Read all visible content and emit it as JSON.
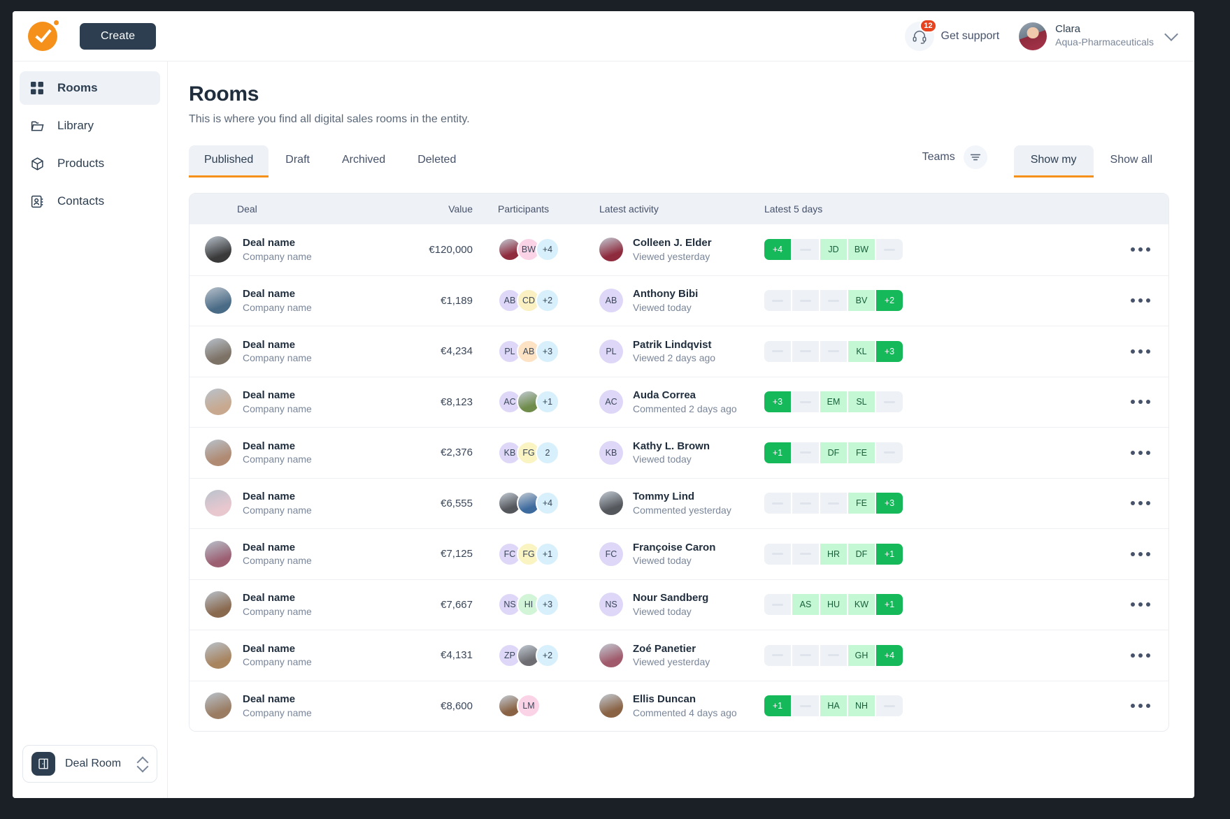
{
  "topbar": {
    "create_label": "Create",
    "support_label": "Get support",
    "support_badge": "12",
    "profile_name": "Clara",
    "profile_org": "Aqua-Pharmaceuticals"
  },
  "sidebar": {
    "items": [
      {
        "label": "Rooms",
        "icon": "grid-icon",
        "active": true
      },
      {
        "label": "Library",
        "icon": "folder-icon",
        "active": false
      },
      {
        "label": "Products",
        "icon": "cube-icon",
        "active": false
      },
      {
        "label": "Contacts",
        "icon": "contacts-icon",
        "active": false
      }
    ],
    "workspace_selector": {
      "label": "Deal Room",
      "icon": "door-icon"
    }
  },
  "page": {
    "title": "Rooms",
    "subtitle": "This is where you find all digital sales rooms in the entity."
  },
  "tabs": [
    {
      "label": "Published",
      "active": true
    },
    {
      "label": "Draft",
      "active": false
    },
    {
      "label": "Archived",
      "active": false
    },
    {
      "label": "Deleted",
      "active": false
    }
  ],
  "filters": {
    "teams_label": "Teams",
    "filter_icon": "filter-icon",
    "segments": [
      {
        "label": "Show my",
        "active": true
      },
      {
        "label": "Show all",
        "active": false
      }
    ]
  },
  "table": {
    "columns": [
      "Deal",
      "Value",
      "Participants",
      "Latest activity",
      "Latest 5 days"
    ],
    "rows": [
      {
        "deal": "Deal name",
        "company": "Company name",
        "value": "€120,000",
        "avatar_color": "#3a3a3a",
        "participants": [
          {
            "type": "photo",
            "color": "#8e2b3d"
          },
          {
            "type": "initials",
            "text": "BW",
            "color": "#fbd3e6"
          },
          {
            "type": "more",
            "text": "+4"
          }
        ],
        "activity": {
          "name": "Colleen J. Elder",
          "when": "Viewed yesterday",
          "avatar_type": "photo",
          "avatar_color": "#8e2b3d",
          "initials": ""
        },
        "days": [
          {
            "state": "solid",
            "text": "+4"
          },
          {
            "state": "empty",
            "text": ""
          },
          {
            "state": "light",
            "text": "JD"
          },
          {
            "state": "light",
            "text": "BW"
          },
          {
            "state": "empty",
            "text": ""
          }
        ]
      },
      {
        "deal": "Deal name",
        "company": "Company name",
        "value": "€1,189",
        "avatar_color": "#4a6b86",
        "participants": [
          {
            "type": "initials",
            "text": "AB",
            "color": "#ded7f7"
          },
          {
            "type": "initials",
            "text": "CD",
            "color": "#faf0c2"
          },
          {
            "type": "more",
            "text": "+2"
          }
        ],
        "activity": {
          "name": "Anthony Bibi",
          "when": "Viewed today",
          "avatar_type": "initials",
          "avatar_color": "#ded7f7",
          "initials": "AB"
        },
        "days": [
          {
            "state": "empty",
            "text": ""
          },
          {
            "state": "empty",
            "text": ""
          },
          {
            "state": "empty",
            "text": ""
          },
          {
            "state": "light",
            "text": "BV"
          },
          {
            "state": "solid",
            "text": "+2"
          }
        ]
      },
      {
        "deal": "Deal name",
        "company": "Company name",
        "value": "€4,234",
        "avatar_color": "#7d7266",
        "participants": [
          {
            "type": "initials",
            "text": "PL",
            "color": "#ded7f7"
          },
          {
            "type": "initials",
            "text": "AB",
            "color": "#fde2c4"
          },
          {
            "type": "more",
            "text": "+3"
          }
        ],
        "activity": {
          "name": "Patrik Lindqvist",
          "when": "Viewed 2 days ago",
          "avatar_type": "initials",
          "avatar_color": "#ded7f7",
          "initials": "PL"
        },
        "days": [
          {
            "state": "empty",
            "text": ""
          },
          {
            "state": "empty",
            "text": ""
          },
          {
            "state": "empty",
            "text": ""
          },
          {
            "state": "light",
            "text": "KL"
          },
          {
            "state": "solid",
            "text": "+3"
          }
        ]
      },
      {
        "deal": "Deal name",
        "company": "Company name",
        "value": "€8,123",
        "avatar_color": "#c8a98f",
        "participants": [
          {
            "type": "initials",
            "text": "AC",
            "color": "#ded7f7"
          },
          {
            "type": "photo",
            "color": "#6f8c4a"
          },
          {
            "type": "more",
            "text": "+1"
          }
        ],
        "activity": {
          "name": "Auda Correa",
          "when": "Commented 2 days ago",
          "avatar_type": "initials",
          "avatar_color": "#ded7f7",
          "initials": "AC"
        },
        "days": [
          {
            "state": "solid",
            "text": "+3"
          },
          {
            "state": "empty",
            "text": ""
          },
          {
            "state": "light",
            "text": "EM"
          },
          {
            "state": "light",
            "text": "SL"
          },
          {
            "state": "empty",
            "text": ""
          }
        ]
      },
      {
        "deal": "Deal name",
        "company": "Company name",
        "value": "€2,376",
        "avatar_color": "#b08a72",
        "participants": [
          {
            "type": "initials",
            "text": "KB",
            "color": "#ded7f7"
          },
          {
            "type": "initials",
            "text": "FG",
            "color": "#faf3c2"
          },
          {
            "type": "more",
            "text": "2"
          }
        ],
        "activity": {
          "name": "Kathy L. Brown",
          "when": "Viewed today",
          "avatar_type": "initials",
          "avatar_color": "#ded7f7",
          "initials": "KB"
        },
        "days": [
          {
            "state": "solid",
            "text": "+1"
          },
          {
            "state": "empty",
            "text": ""
          },
          {
            "state": "light",
            "text": "DF"
          },
          {
            "state": "light",
            "text": "FE"
          },
          {
            "state": "empty",
            "text": ""
          }
        ]
      },
      {
        "deal": "Deal name",
        "company": "Company name",
        "value": "€6,555",
        "avatar_color": "#e8c7cf",
        "participants": [
          {
            "type": "photo",
            "color": "#54575c"
          },
          {
            "type": "photo",
            "color": "#3d6b9e"
          },
          {
            "type": "more",
            "text": "+4"
          }
        ],
        "activity": {
          "name": "Tommy Lind",
          "when": "Commented yesterday",
          "avatar_type": "photo",
          "avatar_color": "#54575c",
          "initials": ""
        },
        "days": [
          {
            "state": "empty",
            "text": ""
          },
          {
            "state": "empty",
            "text": ""
          },
          {
            "state": "empty",
            "text": ""
          },
          {
            "state": "light",
            "text": "FE"
          },
          {
            "state": "solid",
            "text": "+3"
          }
        ]
      },
      {
        "deal": "Deal name",
        "company": "Company name",
        "value": "€7,125",
        "avatar_color": "#9c5f72",
        "participants": [
          {
            "type": "initials",
            "text": "FC",
            "color": "#ded7f7"
          },
          {
            "type": "initials",
            "text": "FG",
            "color": "#faf3c2"
          },
          {
            "type": "more",
            "text": "+1"
          }
        ],
        "activity": {
          "name": "Françoise Caron",
          "when": "Viewed today",
          "avatar_type": "initials",
          "avatar_color": "#ded7f7",
          "initials": "FC"
        },
        "days": [
          {
            "state": "empty",
            "text": ""
          },
          {
            "state": "empty",
            "text": ""
          },
          {
            "state": "light",
            "text": "HR"
          },
          {
            "state": "light",
            "text": "DF"
          },
          {
            "state": "solid",
            "text": "+1"
          }
        ]
      },
      {
        "deal": "Deal name",
        "company": "Company name",
        "value": "€7,667",
        "avatar_color": "#8a6a4f",
        "participants": [
          {
            "type": "initials",
            "text": "NS",
            "color": "#ded7f7"
          },
          {
            "type": "initials",
            "text": "HI",
            "color": "#d2f5d7"
          },
          {
            "type": "more",
            "text": "+3"
          }
        ],
        "activity": {
          "name": "Nour Sandberg",
          "when": "Viewed today",
          "avatar_type": "initials",
          "avatar_color": "#ded7f7",
          "initials": "NS"
        },
        "days": [
          {
            "state": "empty",
            "text": ""
          },
          {
            "state": "light",
            "text": "AS"
          },
          {
            "state": "light",
            "text": "HU"
          },
          {
            "state": "light",
            "text": "KW"
          },
          {
            "state": "solid",
            "text": "+1"
          }
        ]
      },
      {
        "deal": "Deal name",
        "company": "Company name",
        "value": "€4,131",
        "avatar_color": "#a8845f",
        "participants": [
          {
            "type": "initials",
            "text": "ZP",
            "color": "#ded7f7"
          },
          {
            "type": "photo",
            "color": "#6d6d72"
          },
          {
            "type": "more",
            "text": "+2"
          }
        ],
        "activity": {
          "name": "Zoé Panetier",
          "when": "Viewed yesterday",
          "avatar_type": "photo",
          "avatar_color": "#a05a6b",
          "initials": ""
        },
        "days": [
          {
            "state": "empty",
            "text": ""
          },
          {
            "state": "empty",
            "text": ""
          },
          {
            "state": "empty",
            "text": ""
          },
          {
            "state": "light",
            "text": "GH"
          },
          {
            "state": "solid",
            "text": "+4"
          }
        ]
      },
      {
        "deal": "Deal name",
        "company": "Company name",
        "value": "€8,600",
        "avatar_color": "#9a7c62",
        "participants": [
          {
            "type": "photo",
            "color": "#8a6344"
          },
          {
            "type": "initials",
            "text": "LM",
            "color": "#fbd3e6"
          }
        ],
        "activity": {
          "name": "Ellis Duncan",
          "when": "Commented 4 days ago",
          "avatar_type": "photo",
          "avatar_color": "#8a6344",
          "initials": ""
        },
        "days": [
          {
            "state": "solid",
            "text": "+1"
          },
          {
            "state": "empty",
            "text": ""
          },
          {
            "state": "light",
            "text": "HA"
          },
          {
            "state": "light",
            "text": "NH"
          },
          {
            "state": "empty",
            "text": ""
          }
        ]
      }
    ],
    "row_menu_icon": "ellipsis-icon"
  },
  "colors": {
    "accent": "#f5901b",
    "dark": "#2c3e50",
    "green_solid": "#16b95a",
    "green_light": "#c4f7d4",
    "badge_red": "#e8431f"
  }
}
